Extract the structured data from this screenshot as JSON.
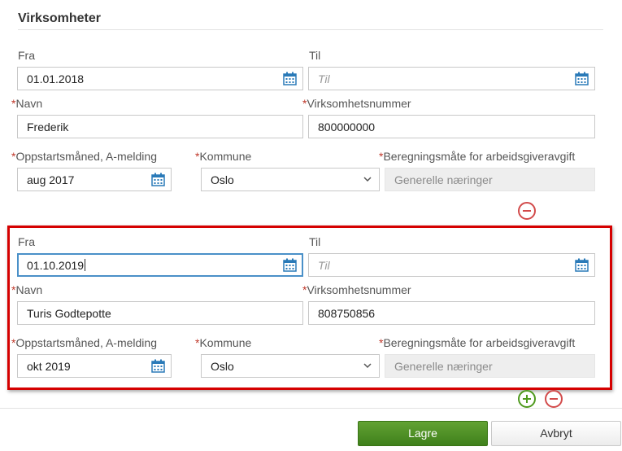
{
  "section": {
    "title": "Virksomheter"
  },
  "required_marker": "*",
  "blocks": [
    {
      "fra_label": "Fra",
      "fra_value": "01.01.2018",
      "til_label": "Til",
      "til_placeholder": "Til",
      "navn_label": "Navn",
      "navn_value": "Frederik",
      "orgnr_label": "Virksomhetsnummer",
      "orgnr_value": "800000000",
      "oppstart_label": "Oppstartsmåned, A-melding",
      "oppstart_value": "aug 2017",
      "kommune_label": "Kommune",
      "kommune_value": "Oslo",
      "beregning_label": "Beregningsmåte for arbeidsgiveravgift",
      "beregning_value": "Generelle næringer"
    },
    {
      "fra_label": "Fra",
      "fra_value": "01.10.2019",
      "til_label": "Til",
      "til_placeholder": "Til",
      "navn_label": "Navn",
      "navn_value": "Turis Godtepotte",
      "orgnr_label": "Virksomhetsnummer",
      "orgnr_value": "808750856",
      "oppstart_label": "Oppstartsmåned, A-melding",
      "oppstart_value": "okt 2019",
      "kommune_label": "Kommune",
      "kommune_value": "Oslo",
      "beregning_label": "Beregningsmåte for arbeidsgiveravgift",
      "beregning_value": "Generelle næringer"
    }
  ],
  "footer": {
    "save_label": "Lagre",
    "cancel_label": "Avbryt"
  },
  "colors": {
    "highlight": "#d50000",
    "primary": "#4f9a1e",
    "remove": "#d24a4a",
    "focus": "#4a90c8",
    "calendar": "#2a7ab8"
  }
}
